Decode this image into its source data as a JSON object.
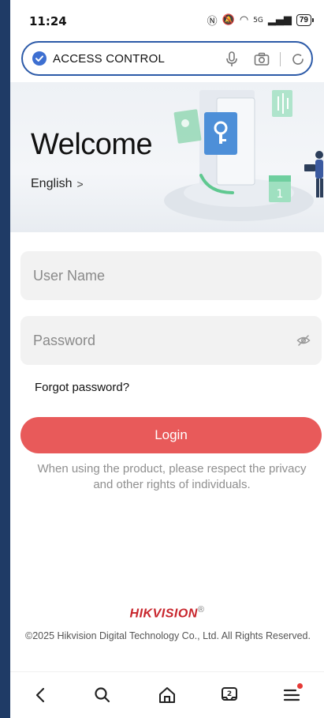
{
  "status_bar": {
    "time": "11:24",
    "network": "5G",
    "battery": "79"
  },
  "address_bar": {
    "title": "ACCESS CONTROL",
    "icons": [
      "shield-icon",
      "microphone-icon",
      "camera-icon",
      "refresh-icon"
    ]
  },
  "hero": {
    "welcome": "Welcome",
    "language": "English",
    "language_chevron": ">"
  },
  "form": {
    "username_placeholder": "User Name",
    "password_placeholder": "Password",
    "forgot_password": "Forgot password?",
    "login_label": "Login",
    "privacy_notice": "When using the product, please respect the privacy and other rights of individuals."
  },
  "footer": {
    "brand": "HIKVISION",
    "brand_mark": "®",
    "copyright": "©2025 Hikvision Digital Technology Co., Ltd. All Rights Reserved."
  },
  "bottom_nav": {
    "items": [
      "back-icon",
      "search-icon",
      "home-icon",
      "tabs-icon",
      "menu-icon"
    ],
    "tabs_count": "2"
  },
  "colors": {
    "background": "#1f3b66",
    "accent": "#2c5aa8",
    "login_button": "#e85a5a",
    "brand": "#c8252c"
  }
}
